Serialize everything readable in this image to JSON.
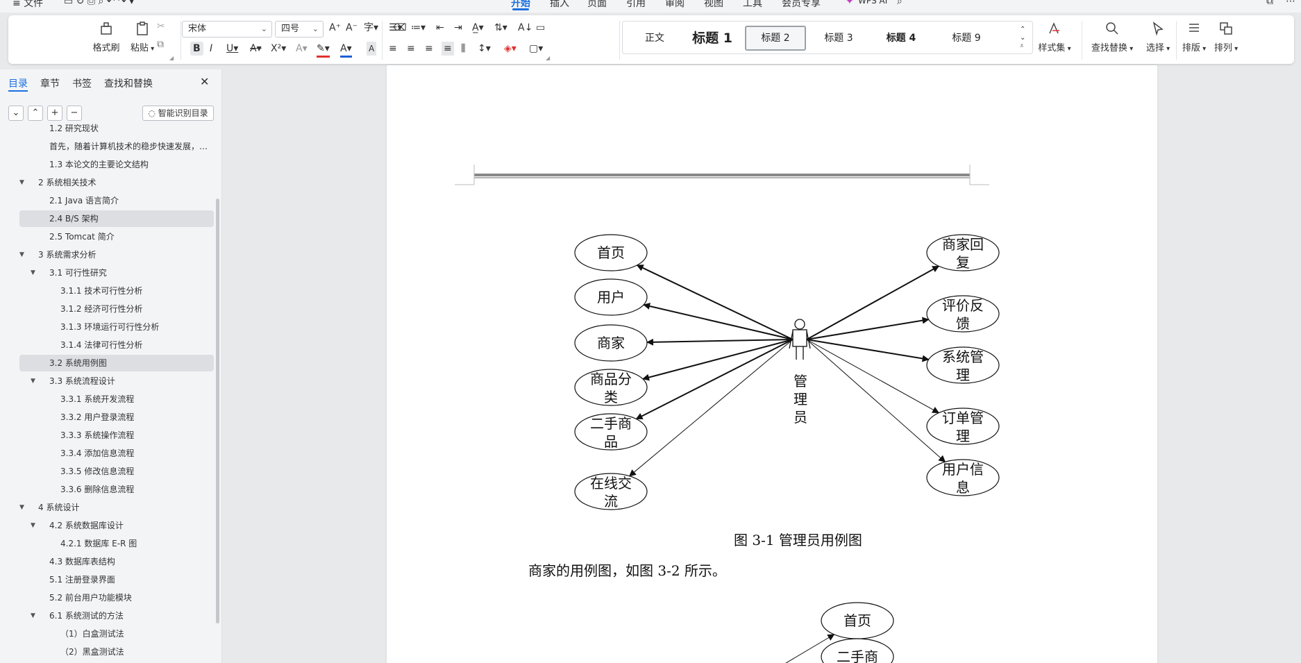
{
  "menubar": {
    "file": "文件",
    "tabs": [
      "开始",
      "插入",
      "页面",
      "引用",
      "审阅",
      "视图",
      "工具",
      "会员专享"
    ],
    "active_tab": "开始",
    "wps_ai": "WPS AI"
  },
  "ribbon": {
    "format_painter": "格式刷",
    "paste": "粘贴",
    "font_name": "宋体",
    "font_size": "四号",
    "styles": [
      "正文",
      "标题 1",
      "标题 2",
      "标题 3",
      "标题 4",
      "标题 9"
    ],
    "selected_style": "标题 2",
    "style_set": "样式集",
    "find_replace": "查找替换",
    "select": "选择",
    "layout": "排版",
    "arrange": "排列",
    "font_color": "#1a5fd6",
    "highlight_color": "#e03030"
  },
  "nav": {
    "tabs": [
      "目录",
      "章节",
      "书签",
      "查找和替换"
    ],
    "active_tab": "目录",
    "smart_toc": "智能识别目录",
    "items": [
      {
        "text": "1.2 研究现状",
        "level": 2
      },
      {
        "text": "首先，随着计算机技术的稳步快速发展，各 ...",
        "level": 2
      },
      {
        "text": "1.3 本论文的主要论文结构",
        "level": 2
      },
      {
        "text": "2 系统相关技术",
        "level": 1
      },
      {
        "text": "2.1 Java 语言简介",
        "level": 2
      },
      {
        "text": "2.4 B/S 架构",
        "level": 2,
        "highlighted": true
      },
      {
        "text": "2.5 Tomcat 简介",
        "level": 2
      },
      {
        "text": "3 系统需求分析",
        "level": 1
      },
      {
        "text": "3.1 可行性研究",
        "level": 2
      },
      {
        "text": "3.1.1 技术可行性分析",
        "level": 3
      },
      {
        "text": "3.1.2  经济可行性分析",
        "level": 3
      },
      {
        "text": "3.1.3  环境运行可行性分析",
        "level": 3
      },
      {
        "text": "3.1.4  法律可行性分析",
        "level": 3
      },
      {
        "text": "3.2 系统用例图",
        "level": 2,
        "highlighted": true
      },
      {
        "text": "3.3 系统流程设计",
        "level": 2
      },
      {
        "text": "3.3.1  系统开发流程",
        "level": 3
      },
      {
        "text": "3.3.2  用户登录流程",
        "level": 3
      },
      {
        "text": "3.3.3  系统操作流程",
        "level": 3
      },
      {
        "text": "3.3.4  添加信息流程",
        "level": 3
      },
      {
        "text": "3.3.5  修改信息流程",
        "level": 3
      },
      {
        "text": "3.3.6  删除信息流程",
        "level": 3
      },
      {
        "text": "4 系统设计",
        "level": 1
      },
      {
        "text": "4.2 系统数据库设计",
        "level": 2
      },
      {
        "text": "4.2.1 数据库 E-R 图",
        "level": 3
      },
      {
        "text": "4.3 数据库表结构",
        "level": 2
      },
      {
        "text": "5.1 注册登录界面",
        "level": 2
      },
      {
        "text": "5.2 前台用户功能模块",
        "level": 2
      },
      {
        "text": "6.1 系统测试的方法",
        "level": 2
      },
      {
        "text": "（1）白盒测试法",
        "level": 3
      },
      {
        "text": "（2）黑盒测试法",
        "level": 3
      }
    ]
  },
  "document": {
    "actor_label": [
      "管",
      "理",
      "员"
    ],
    "left_cases": [
      [
        "首页"
      ],
      [
        "用户"
      ],
      [
        "商家"
      ],
      [
        "商品分",
        "类"
      ],
      [
        "二手商",
        "品"
      ],
      [
        "在线交",
        "流"
      ]
    ],
    "right_cases": [
      [
        "商家回",
        "复"
      ],
      [
        "评价反",
        "馈"
      ],
      [
        "系统管",
        "理"
      ],
      [
        "订单管",
        "理"
      ],
      [
        "用户信",
        "息"
      ]
    ],
    "caption": "图 3-1 管理员用例图",
    "paragraph": "商家的用例图，如图 3-2 所示。",
    "next_cases": [
      [
        "首页"
      ],
      [
        "二手商"
      ]
    ]
  }
}
